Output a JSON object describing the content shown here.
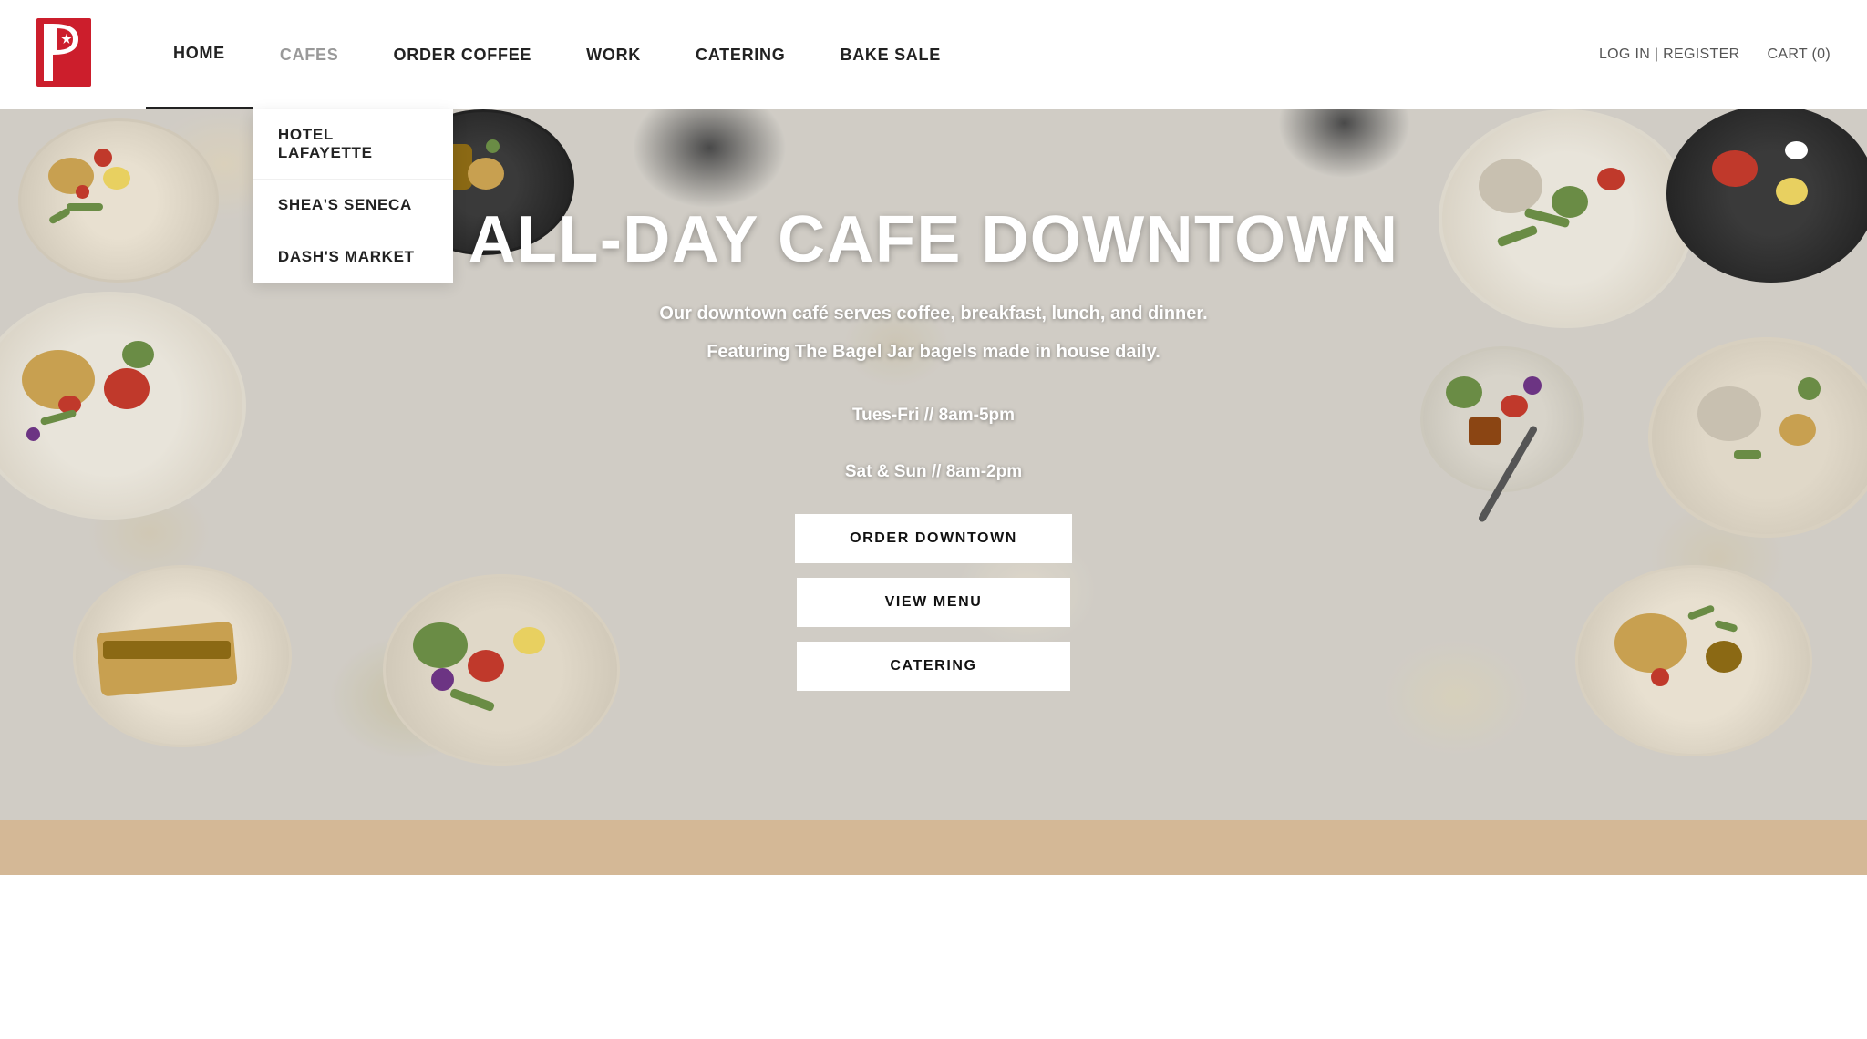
{
  "navbar": {
    "logo_letter": "P",
    "nav_items": [
      {
        "id": "home",
        "label": "HOME",
        "active": true
      },
      {
        "id": "cafes",
        "label": "CAFES",
        "active": false,
        "has_dropdown": true
      },
      {
        "id": "order-coffee",
        "label": "ORDER COFFEE",
        "active": false
      },
      {
        "id": "work",
        "label": "WORK",
        "active": false
      },
      {
        "id": "catering",
        "label": "CATERING",
        "active": false
      },
      {
        "id": "bake-sale",
        "label": "BAKE SALE",
        "active": false
      }
    ],
    "dropdown_items": [
      {
        "id": "hotel-lafayette",
        "label": "HOTEL LAFAYETTE"
      },
      {
        "id": "sheas-seneca",
        "label": "SHEA'S SENECA"
      },
      {
        "id": "dashs-market",
        "label": "DASH'S MARKET"
      }
    ],
    "login_label": "LOG IN | REGISTER",
    "cart_label": "CART (0)"
  },
  "hero": {
    "title": "ALL-DAY CAFE DOWNTOWN",
    "subtitle_line1": "Our downtown café serves coffee, breakfast, lunch, and dinner.",
    "subtitle_line2": "Featuring The Bagel Jar bagels made in house daily.",
    "hours_line1": "Tues-Fri // 8am-5pm",
    "hours_line2": "Sat & Sun // 8am-2pm",
    "buttons": [
      {
        "id": "order-downtown",
        "label": "ORDER DOWNTOWN"
      },
      {
        "id": "view-menu",
        "label": "VIEW MENU"
      },
      {
        "id": "catering",
        "label": "CATERING"
      }
    ]
  }
}
